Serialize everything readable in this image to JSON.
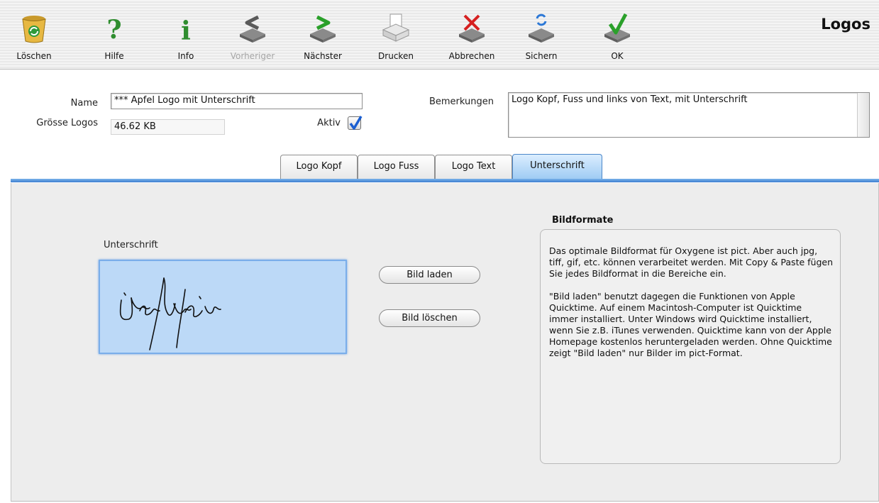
{
  "window": {
    "title": "Logos"
  },
  "toolbar": {
    "buttons": [
      {
        "label": "Löschen",
        "icon": "trash-recycle-icon",
        "enabled": true
      },
      {
        "label": "Hilfe",
        "icon": "question-icon",
        "enabled": true
      },
      {
        "label": "Info",
        "icon": "info-icon",
        "enabled": true
      },
      {
        "label": "Vorheriger",
        "icon": "previous-record-icon",
        "enabled": false
      },
      {
        "label": "Nächster",
        "icon": "next-record-icon",
        "enabled": true
      },
      {
        "label": "Drucken",
        "icon": "printer-icon",
        "enabled": true
      },
      {
        "label": "Abbrechen",
        "icon": "cancel-icon",
        "enabled": true
      },
      {
        "label": "Sichern",
        "icon": "save-icon",
        "enabled": true
      },
      {
        "label": "OK",
        "icon": "ok-check-icon",
        "enabled": true
      }
    ]
  },
  "form": {
    "name_label": "Name",
    "name_value": "*** Apfel Logo mit Unterschrift",
    "size_label": "Grösse Logos",
    "size_value": "46.62 KB",
    "active_label": "Aktiv",
    "active_checked": true,
    "remarks_label": "Bemerkungen",
    "remarks_value": "Logo Kopf, Fuss und links von Text, mit Unterschrift"
  },
  "tabs": [
    {
      "label": "Logo Kopf",
      "active": false
    },
    {
      "label": "Logo Fuss",
      "active": false
    },
    {
      "label": "Logo Text",
      "active": false
    },
    {
      "label": "Unterschrift",
      "active": true
    }
  ],
  "signature": {
    "label": "Unterschrift",
    "load_button": "Bild laden",
    "delete_button": "Bild löschen"
  },
  "info": {
    "title": "Bildformate",
    "paragraph1": "Das optimale Bildformat für Oxygene ist pict. Aber auch jpg, tiff, gif, etc. können verarbeitet werden. Mit Copy & Paste fügen Sie jedes Bildformat in die Bereiche ein.",
    "paragraph2": "\"Bild laden\" benutzt dagegen die Funktionen von Apple Quicktime. Auf einem Macintosh-Computer ist Quicktime immer installiert. Unter Windows wird Quicktime installiert, wenn Sie z.B. iTunes verwenden. Quicktime kann von der Apple Homepage kostenlos heruntergeladen werden. Ohne Quicktime zeigt \"Bild laden\" nur Bilder im pict-Format."
  },
  "colors": {
    "accent_blue": "#3d7ed0",
    "selection_blue": "#bcd9f7",
    "checkbox_blue": "#1b5fd1",
    "ok_green": "#2aa02a",
    "cancel_red": "#d62020"
  }
}
